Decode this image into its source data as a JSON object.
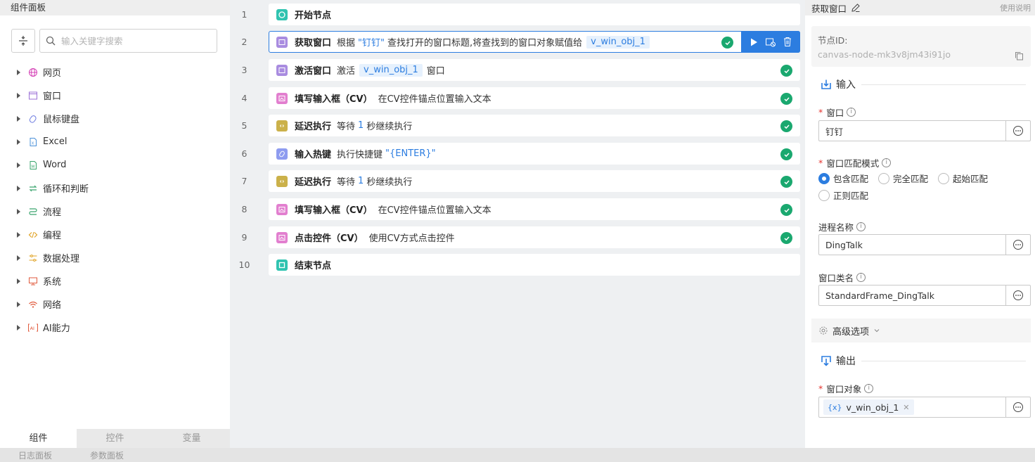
{
  "left_panel": {
    "title": "组件面板",
    "search_placeholder": "输入关键字搜索",
    "categories": [
      {
        "label": "网页",
        "icon": "globe-icon"
      },
      {
        "label": "窗口",
        "icon": "window-icon"
      },
      {
        "label": "鼠标键盘",
        "icon": "mouse-icon"
      },
      {
        "label": "Excel",
        "icon": "excel-icon"
      },
      {
        "label": "Word",
        "icon": "word-icon"
      },
      {
        "label": "循环和判断",
        "icon": "loop-icon"
      },
      {
        "label": "流程",
        "icon": "flow-icon"
      },
      {
        "label": "编程",
        "icon": "code-icon"
      },
      {
        "label": "数据处理",
        "icon": "data-icon"
      },
      {
        "label": "系统",
        "icon": "monitor-icon"
      },
      {
        "label": "网络",
        "icon": "wifi-icon"
      },
      {
        "label": "AI能力",
        "icon": "ai-icon"
      }
    ],
    "tabs": [
      "组件",
      "控件",
      "变量"
    ],
    "active_tab": "组件"
  },
  "statusbar": {
    "log_panel": "日志面板",
    "param_panel": "参数面板"
  },
  "flow": {
    "nodes": [
      {
        "num": "1",
        "title": "开始节点",
        "kind": "start"
      },
      {
        "num": "2",
        "title": "获取窗口",
        "desc_a": "根据",
        "hl": "\"钉钉\"",
        "desc_b": "查找打开的窗口标题,将查找到的窗口对象赋值给",
        "var": "v_win_obj_1",
        "kind": "window"
      },
      {
        "num": "3",
        "title": "激活窗口",
        "desc_a": "激活",
        "var": "v_win_obj_1",
        "desc_b": "窗口",
        "kind": "window"
      },
      {
        "num": "4",
        "title": "填写输入框（CV）",
        "desc_a": "在CV控件锚点位置输入文本",
        "kind": "cv"
      },
      {
        "num": "5",
        "title": "延迟执行",
        "desc_a": "等待",
        "hl": "1",
        "desc_b": "秒继续执行",
        "kind": "delay"
      },
      {
        "num": "6",
        "title": "输入热键",
        "desc_a": "执行快捷键",
        "hl": "\"{ENTER}\"",
        "kind": "hotkey"
      },
      {
        "num": "7",
        "title": "延迟执行",
        "desc_a": "等待",
        "hl": "1",
        "desc_b": "秒继续执行",
        "kind": "delay"
      },
      {
        "num": "8",
        "title": "填写输入框（CV）",
        "desc_a": "在CV控件锚点位置输入文本",
        "kind": "cv"
      },
      {
        "num": "9",
        "title": "点击控件（CV）",
        "desc_a": "使用CV方式点击控件",
        "kind": "cv"
      },
      {
        "num": "10",
        "title": "结束节点",
        "kind": "end"
      }
    ]
  },
  "right_panel": {
    "title": "获取窗口",
    "help": "使用说明",
    "node_id_label": "节点ID:",
    "node_id": "canvas-node-mk3v8jm43i91jo",
    "input_section": "输入",
    "window_label": "窗口",
    "window_value": "钉钉",
    "match_mode_label": "窗口匹配模式",
    "match_modes": [
      "包含匹配",
      "完全匹配",
      "起始匹配",
      "正则匹配"
    ],
    "selected_mode": "包含匹配",
    "process_label": "进程名称",
    "process_value": "DingTalk",
    "class_label": "窗口类名",
    "class_value": "StandardFrame_DingTalk",
    "advanced": "高级选项",
    "output_section": "输出",
    "output_label": "窗口对象",
    "output_var": "v_win_obj_1"
  },
  "colors": {
    "accent": "#2c7de0",
    "success": "#1aa86f",
    "required": "#e5322d"
  }
}
